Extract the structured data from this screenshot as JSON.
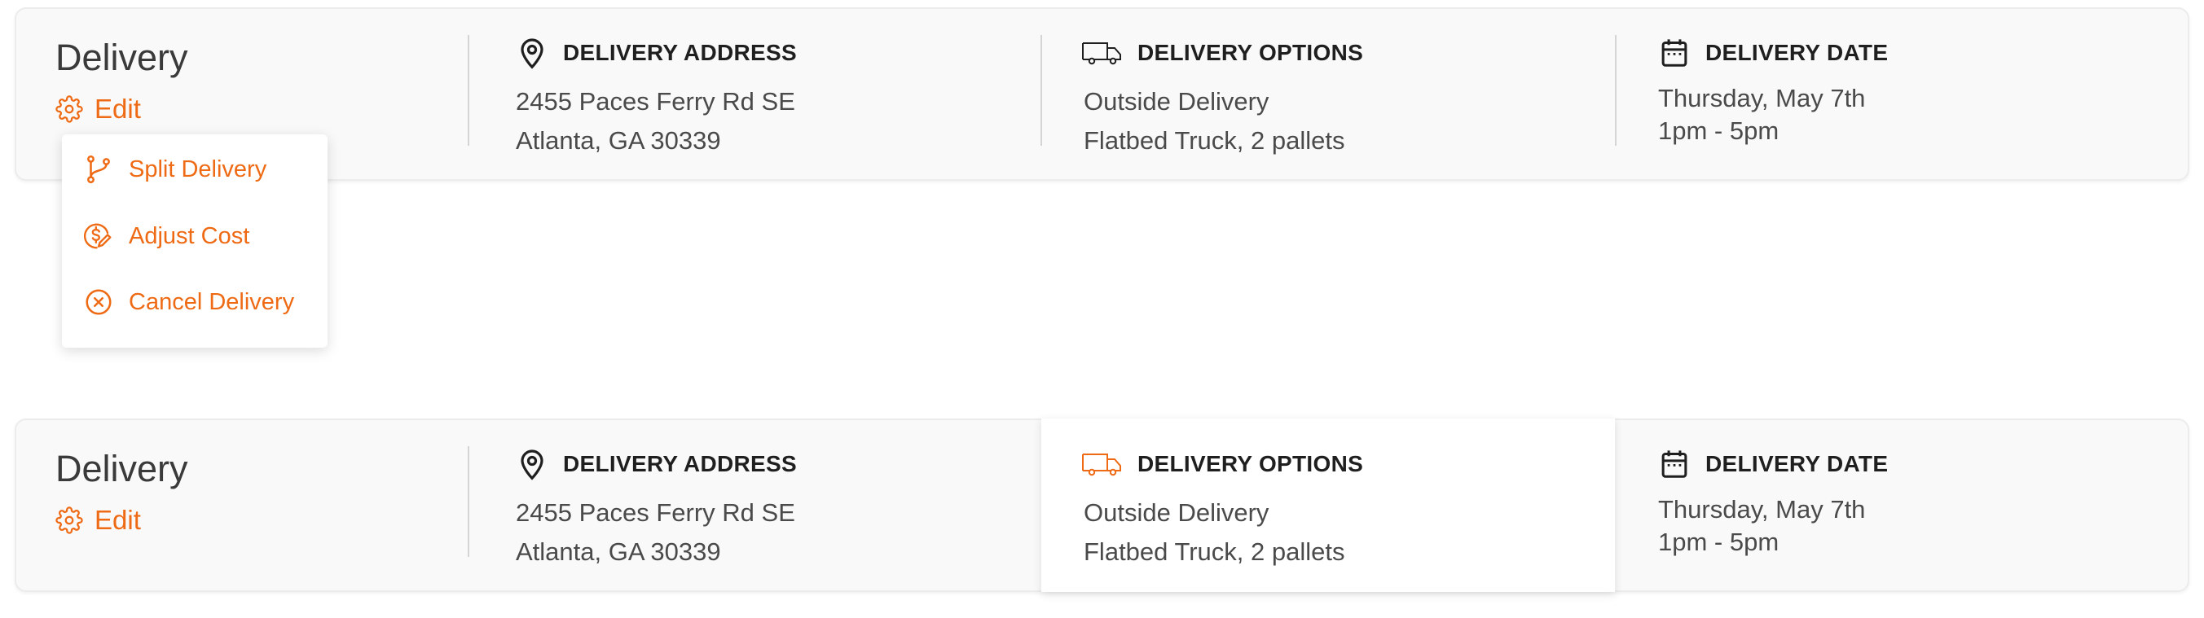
{
  "colors": {
    "accent": "#ee6a14",
    "text": "#3f3f3f",
    "card_bg": "#f9f9f9"
  },
  "card1": {
    "title": "Delivery",
    "edit_label": "Edit",
    "address": {
      "heading": "DELIVERY ADDRESS",
      "line1": "2455 Paces Ferry Rd SE",
      "line2": "Atlanta, GA 30339",
      "icon": "map-pin-icon"
    },
    "options": {
      "heading": "DELIVERY OPTIONS",
      "line1": "Outside Delivery",
      "line2": "Flatbed Truck, 2 pallets",
      "icon": "truck-icon"
    },
    "date": {
      "heading": "DELIVERY DATE",
      "line1": "Thursday, May 7th",
      "line2": "1pm - 5pm",
      "icon": "calendar-icon"
    }
  },
  "edit_menu": {
    "items": [
      {
        "label": "Split Delivery",
        "icon": "split-branch-icon"
      },
      {
        "label": "Adjust Cost",
        "icon": "dollar-edit-icon"
      },
      {
        "label": "Cancel Delivery",
        "icon": "cancel-circle-icon"
      }
    ]
  },
  "card2": {
    "title": "Delivery",
    "edit_label": "Edit",
    "address": {
      "heading": "DELIVERY ADDRESS",
      "line1": "2455 Paces Ferry Rd SE",
      "line2": "Atlanta, GA 30339",
      "icon": "map-pin-icon"
    },
    "options": {
      "heading": "DELIVERY OPTIONS",
      "line1": "Outside Delivery",
      "line2": "Flatbed Truck, 2 pallets",
      "icon": "truck-icon",
      "hovered": true
    },
    "date": {
      "heading": "DELIVERY DATE",
      "line1": "Thursday, May 7th",
      "line2": "1pm - 5pm",
      "icon": "calendar-icon"
    }
  }
}
